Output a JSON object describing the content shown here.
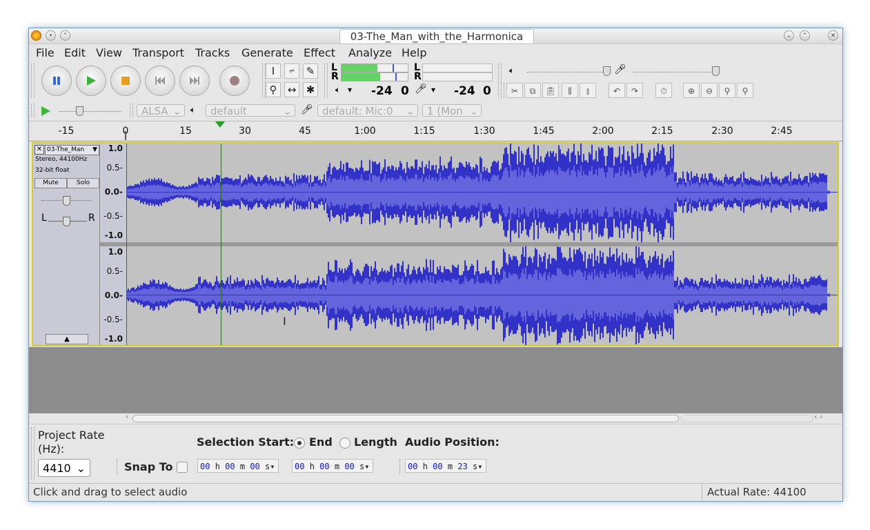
{
  "window": {
    "title": "03-The_Man_with_the_Harmonica"
  },
  "menu": [
    "File",
    "Edit",
    "View",
    "Transport",
    "Tracks",
    "Generate",
    "Effect",
    "Analyze",
    "Help"
  ],
  "meters": {
    "play_db_left": "-24",
    "play_db_zero": "0",
    "rec_db_left": "-24",
    "rec_db_zero": "0",
    "L": "L",
    "R": "R"
  },
  "device": {
    "host": "ALSA",
    "playback": "default",
    "recording": "default: Mic:0",
    "channels": "1 (Mon"
  },
  "timeline": [
    "-15",
    "0",
    "15",
    "30",
    "45",
    "1:00",
    "1:15",
    "1:30",
    "1:45",
    "2:00",
    "2:15",
    "2:30",
    "2:45"
  ],
  "track": {
    "name": "03-The_Man",
    "info1": "Stereo, 44100Hz",
    "info2": "32-bit float",
    "mute": "Mute",
    "solo": "Solo",
    "pan_L": "L",
    "pan_R": "R",
    "scale": [
      "1.0",
      "0.5-",
      "0.0-",
      "-0.5-",
      "-1.0"
    ]
  },
  "selection": {
    "project_rate_label": "Project Rate (Hz):",
    "project_rate": "4410",
    "snap_to": "Snap To",
    "selection_start": "Selection Start:",
    "end": "End",
    "length": "Length",
    "audio_position": "Audio Position:",
    "start_time": [
      "00",
      "h",
      "00",
      "m",
      "00",
      "s"
    ],
    "end_time": [
      "00",
      "h",
      "00",
      "m",
      "00",
      "s"
    ],
    "audio_time": [
      "00",
      "h",
      "00",
      "m",
      "23",
      "s"
    ]
  },
  "status": {
    "message": "Click and drag to select audio",
    "rate": "Actual Rate: 44100"
  },
  "colors": {
    "waveform": "#3232c8",
    "waveform_rms": "#6464dc",
    "track_border": "#d4cc28",
    "play_green": "#3cb43c"
  }
}
